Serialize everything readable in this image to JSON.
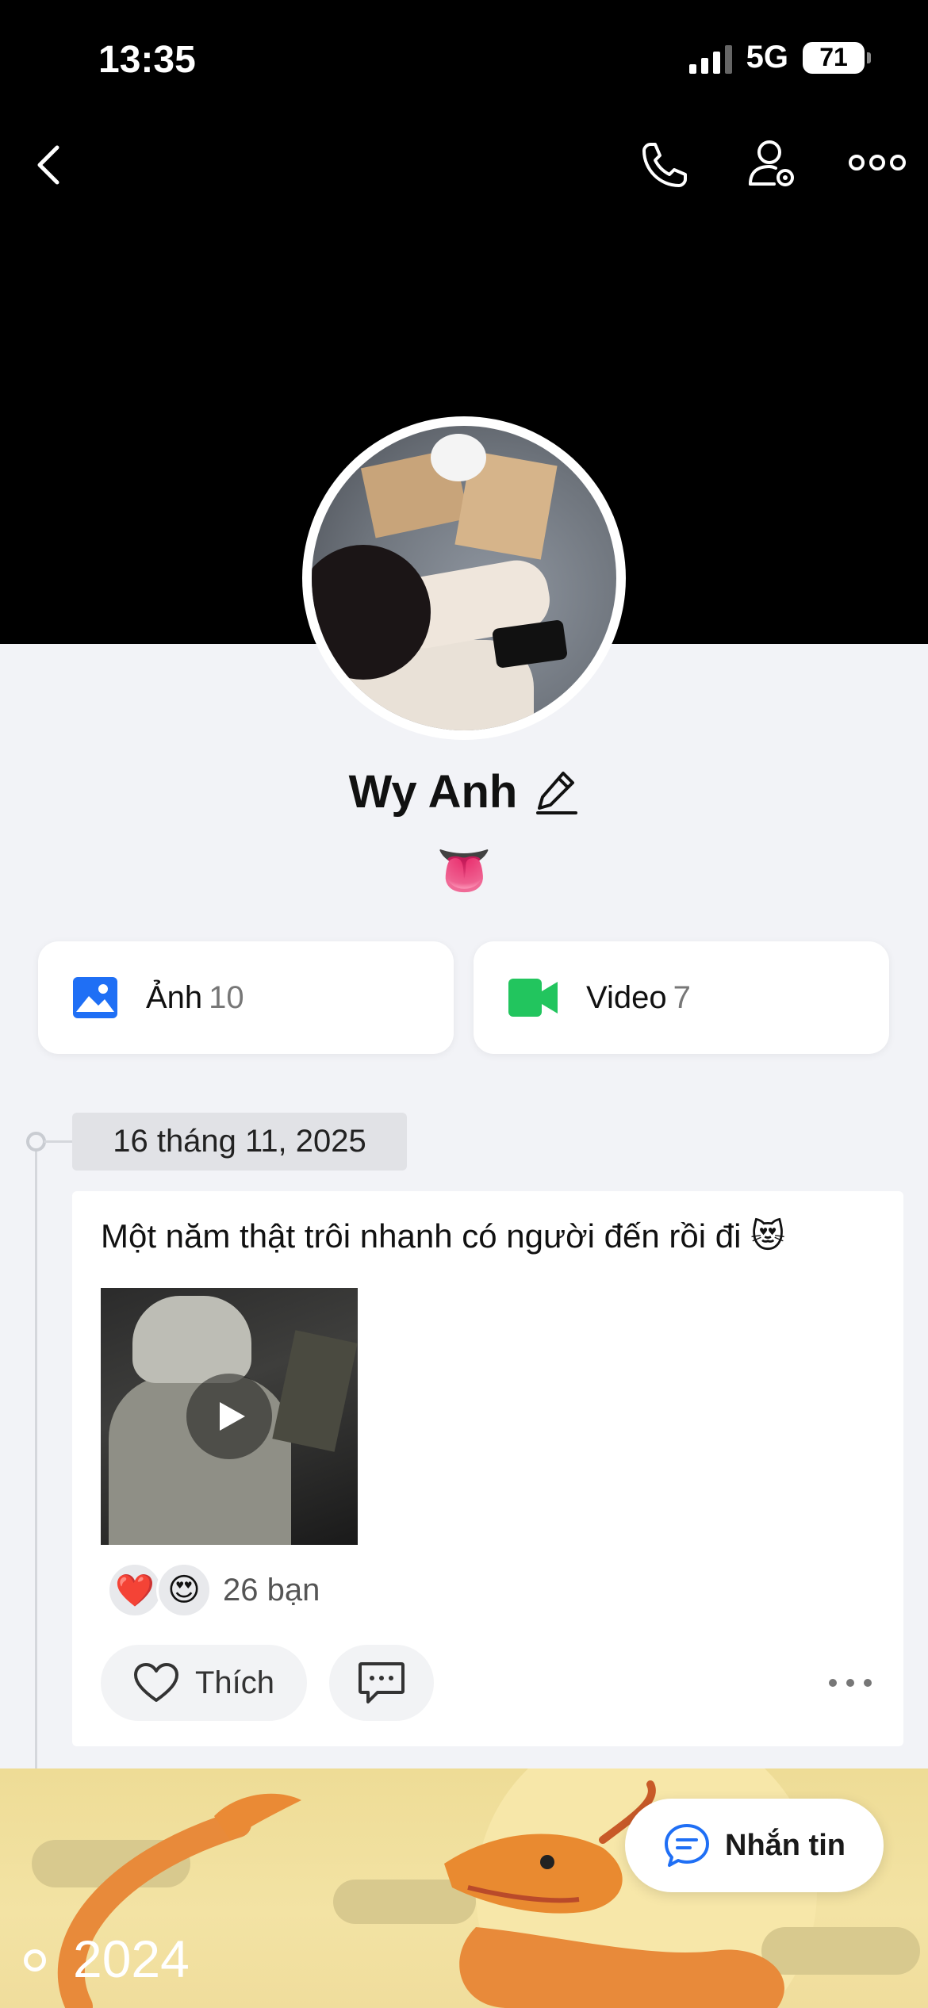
{
  "status_bar": {
    "time": "13:35",
    "network": "5G",
    "battery": "71"
  },
  "profile": {
    "name": "Wy Anh",
    "bio": "👅"
  },
  "media": {
    "photos": {
      "label": "Ảnh",
      "count": "10"
    },
    "videos": {
      "label": "Video",
      "count": "7"
    }
  },
  "timeline": {
    "date": "16 tháng 11, 2025",
    "post": {
      "text": "Một năm thật trôi nhanh có người đến rồi đi 😻",
      "reactions": [
        "❤️",
        "😍"
      ],
      "reaction_count": "26 bạn",
      "like_label": "Thích"
    },
    "year": "2024"
  },
  "chat_button": {
    "label": "Nhắn tin"
  },
  "colors": {
    "accent_blue": "#1f6ff5",
    "video_green": "#22c55e",
    "cover": "#000000"
  }
}
